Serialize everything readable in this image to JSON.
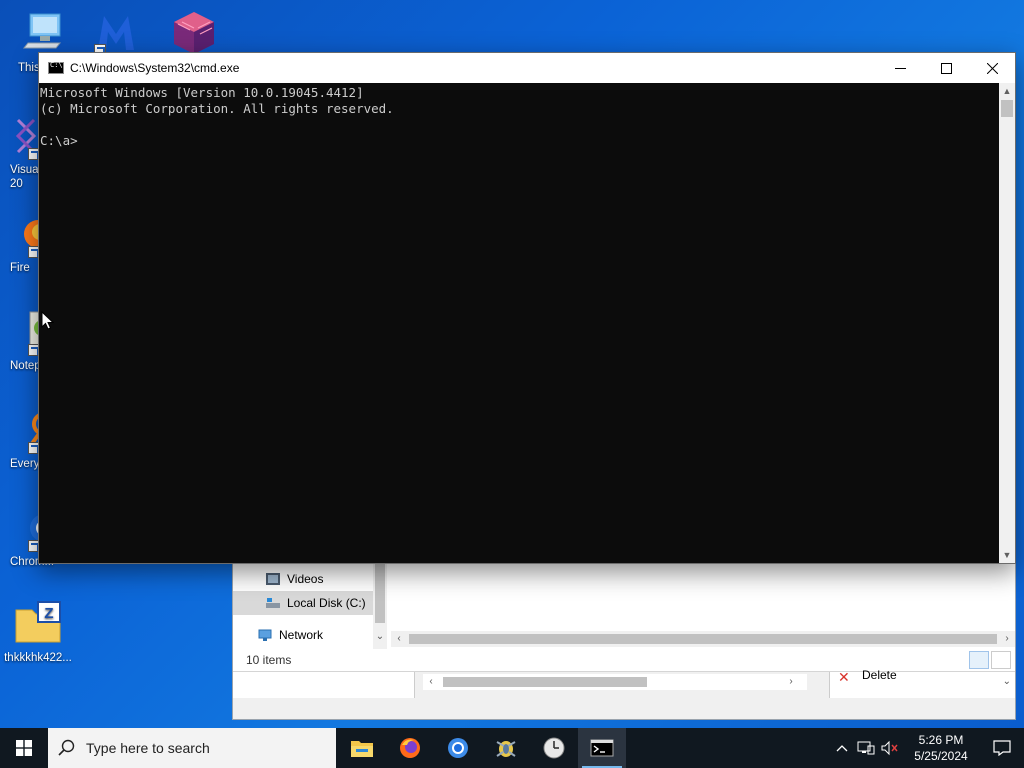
{
  "desktop": {
    "icons": [
      {
        "name": "this-pc",
        "label": "This"
      },
      {
        "name": "malwarebytes",
        "label": ""
      },
      {
        "name": "cube-app",
        "label": ""
      },
      {
        "name": "visual-studio",
        "label": "Visual\n20"
      },
      {
        "name": "firefox",
        "label": "Fire"
      },
      {
        "name": "notepad",
        "label": "Notep"
      },
      {
        "name": "everything",
        "label": "Every"
      },
      {
        "name": "chrome",
        "label": "Chrom..."
      },
      {
        "name": "zip-folder",
        "label": "thkkkhk422..."
      }
    ]
  },
  "explorer": {
    "nav_items": [
      "Videos",
      "Local Disk (C:)",
      "Network"
    ],
    "status": "10 items",
    "ribbon_delete": "Delete"
  },
  "cmd": {
    "title": "C:\\Windows\\System32\\cmd.exe",
    "lines": [
      "Microsoft Windows [Version 10.0.19045.4412]",
      "(c) Microsoft Corporation. All rights reserved.",
      "",
      "C:\\a>"
    ]
  },
  "taskbar": {
    "search_placeholder": "Type here to search",
    "apps": [
      "file-explorer",
      "firefox",
      "chrome",
      "bug-tool",
      "clock-app",
      "cmd"
    ],
    "time": "5:26 PM",
    "date": "5/25/2024"
  },
  "colors": {
    "desktop_bg": "#0b63d6",
    "terminal_bg": "#0c0c0c",
    "terminal_fg": "#cccccc",
    "taskbar_bg": "#101820"
  }
}
